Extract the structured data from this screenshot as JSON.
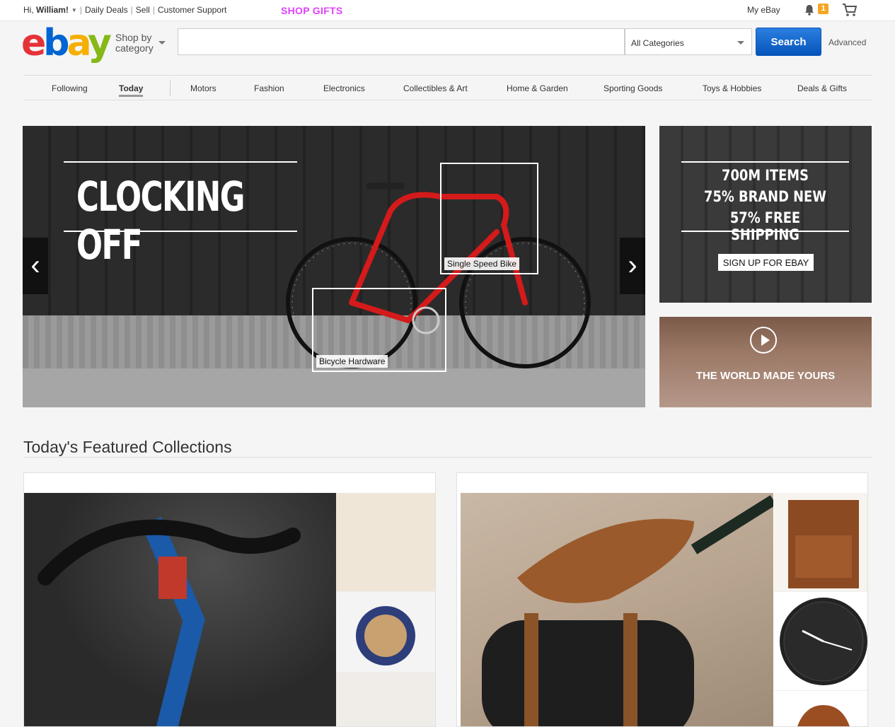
{
  "topbar": {
    "greeting": "Hi,",
    "user": "William!",
    "daily_deals": "Daily Deals",
    "sell": "Sell",
    "support": "Customer Support",
    "shop_gifts": "SHOP GIFTS",
    "my_ebay": "My eBay",
    "notification_count": "1"
  },
  "header": {
    "logo": {
      "e": "e",
      "b": "b",
      "a": "a",
      "y": "y"
    },
    "shop_by_line1": "Shop by",
    "shop_by_line2": "category",
    "search_placeholder": "",
    "category": "All Categories",
    "search_button": "Search",
    "advanced": "Advanced"
  },
  "nav": {
    "items": [
      "Following",
      "Today",
      "Motors",
      "Fashion",
      "Electronics",
      "Collectibles & Art",
      "Home & Garden",
      "Sporting Goods",
      "Toys & Hobbies",
      "Deals & Gifts"
    ]
  },
  "hero": {
    "title": "CLOCKING OFF",
    "hotspot1": "Single Speed Bike",
    "hotspot2": "Bicycle Hardware",
    "prev": "‹",
    "next": "›"
  },
  "promo": {
    "line1": "700M ITEMS",
    "line2": "75% BRAND NEW",
    "line3": "57% FREE SHIPPING",
    "signup": "SIGN UP FOR EBAY",
    "video_tagline": "THE WORLD MADE YOURS"
  },
  "featured": {
    "title": "Today's Featured Collections"
  },
  "colors": {
    "ebay_red": "#e53238",
    "ebay_blue": "#0064d2",
    "ebay_yellow": "#f5af02",
    "ebay_green": "#86b817",
    "search_blue": "#0654ba",
    "accent_magenta": "#e040fb"
  }
}
